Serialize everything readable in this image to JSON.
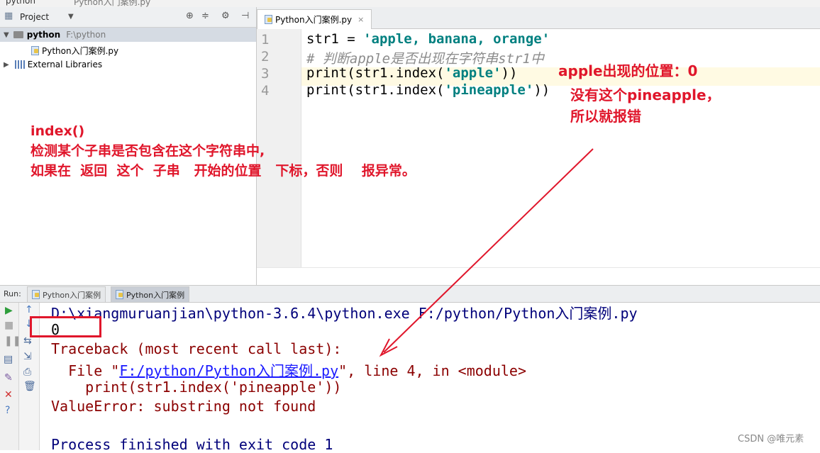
{
  "breadcrumb": [
    "python",
    "Python入门案例.py"
  ],
  "project_panel": {
    "title": "Project",
    "tree": [
      {
        "label": "python",
        "path": "F:\\python"
      },
      {
        "label": "Python入门案例.py"
      },
      {
        "label": "External Libraries"
      }
    ]
  },
  "editor": {
    "tab": "Python入门案例.py",
    "line_numbers": [
      "1",
      "2",
      "3",
      "4"
    ],
    "lines": [
      {
        "a": "str1 = ",
        "b": "'apple, banana, orange'"
      },
      {
        "c": "# 判断apple是否出现在字符串str1中"
      },
      {
        "a": "print(str1.index(",
        "b": "'apple'",
        "d": "))"
      },
      {
        "a": "print(str1.index(",
        "b": "'pineapple'",
        "d": "))"
      }
    ]
  },
  "run": {
    "label": "Run:",
    "tabs": [
      "Python入门案例",
      "Python入门案例"
    ]
  },
  "console": {
    "cmd": "D:\\xiangmuruanjian\\python-3.6.4\\python.exe F:/python/Python入门案例.py",
    "output": "0",
    "traceback": "Traceback (most recent call last):",
    "file_prefix": "  File \"",
    "file_link": "F:/python/Python入门案例.py",
    "file_suffix": "\", line 4, in <module>",
    "code_line": "    print(str1.index('pineapple'))",
    "error": "ValueError: substring not found",
    "finish": "Process finished with exit code 1"
  },
  "annotations": {
    "index_title": "index()",
    "index_desc1": "检测某个子串是否包含在这个字符串中,",
    "index_desc2": "如果在  返回  这个  子串   开始的位置   下标，否则    报异常。",
    "apple_pos": "apple出现的位置：0",
    "no_pineapple1": "没有这个pineapple，",
    "no_pineapple2": "所以就报错"
  },
  "watermark": "CSDN @唯元素",
  "colors": {
    "annotation": "#e0162b",
    "string": "#008080",
    "console_red": "#8b0000"
  }
}
